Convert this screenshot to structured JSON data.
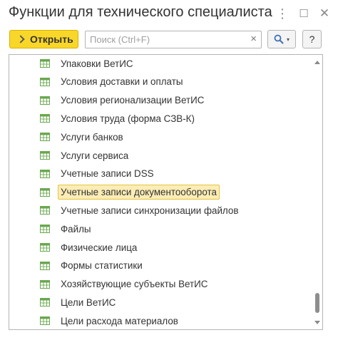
{
  "window": {
    "title": "Функции для технического специалиста",
    "more_glyph": "⋮",
    "maximize_glyph": "☐",
    "close_glyph": "✕"
  },
  "toolbar": {
    "open_label": "Открыть",
    "search_placeholder": "Поиск (Ctrl+F)",
    "search_value": "",
    "clear_glyph": "×",
    "search_dropdown_glyph": "▾",
    "help_label": "?"
  },
  "list": {
    "items": [
      {
        "label": "Упаковки ВетИС",
        "icon": "table-icon"
      },
      {
        "label": "Условия доставки и оплаты",
        "icon": "table-icon"
      },
      {
        "label": "Условия регионализации ВетИС",
        "icon": "table-icon"
      },
      {
        "label": "Условия труда (форма СЗВ-К)",
        "icon": "table-icon"
      },
      {
        "label": "Услуги банков",
        "icon": "table-icon"
      },
      {
        "label": "Услуги сервиса",
        "icon": "table-icon"
      },
      {
        "label": "Учетные записи DSS",
        "icon": "table-icon"
      },
      {
        "label": "Учетные записи документооборота",
        "icon": "table-icon",
        "selected": true
      },
      {
        "label": "Учетные записи синхронизации файлов",
        "icon": "table-icon"
      },
      {
        "label": "Файлы",
        "icon": "table-icon"
      },
      {
        "label": "Физические лица",
        "icon": "table-icon"
      },
      {
        "label": "Формы статистики",
        "icon": "table-icon"
      },
      {
        "label": "Хозяйствующие субъекты ВетИС",
        "icon": "table-icon"
      },
      {
        "label": "Цели ВетИС",
        "icon": "table-icon"
      },
      {
        "label": "Цели расхода материалов",
        "icon": "table-icon"
      }
    ]
  },
  "colors": {
    "accent_button": "#f9d72a",
    "selection_fill": "#fbedb5",
    "selection_border": "#e6c341",
    "icon_green": "#6aa84f"
  }
}
